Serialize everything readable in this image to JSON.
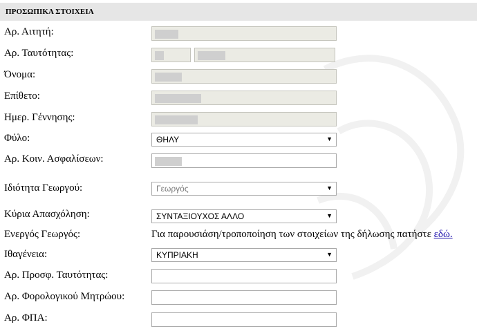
{
  "section": {
    "title": "ΠΡΟΣΩΠΙΚΑ ΣΤΟΙΧΕΙΑ"
  },
  "labels": {
    "applicant_no": "Αρ. Αιτητή:",
    "id_no": "Αρ. Ταυτότητας:",
    "first_name": "Όνομα:",
    "surname": "Επίθετο:",
    "birth_date": "Ημερ. Γέννησης:",
    "sex": "Φύλο:",
    "social_insurance_no": "Αρ. Κοιν. Ασφαλίσεων:",
    "farmer_status": "Ιδιότητα Γεωργού:",
    "main_occupation": "Κύρια Απασχόληση:",
    "active_farmer": "Ενεργός Γεωργός:",
    "nationality": "Ιθαγένεια:",
    "refugee_id_no": "Αρ. Προσφ. Ταυτότητας:",
    "tax_registry_no": "Αρ. Φορολογικού Μητρώου:",
    "vat_no": "Αρ. ΦΠΑ:"
  },
  "selects": {
    "sex": "ΘΗΛΥ",
    "farmer_status": "Γεωργός",
    "main_occupation": "ΣΥΝΤΑΞΙΟΥΧΟΣ ΑΛΛΟ",
    "nationality": "ΚΥΠΡΙΑΚΗ"
  },
  "active_farmer": {
    "text": "Για παρουσιάση/τροποποίηση των στοιχείων της δήλωσης πατήστε ",
    "link": "εδώ."
  },
  "icons": {
    "dropdown": "chevron-down-icon",
    "arrow_glyph": "▼"
  }
}
